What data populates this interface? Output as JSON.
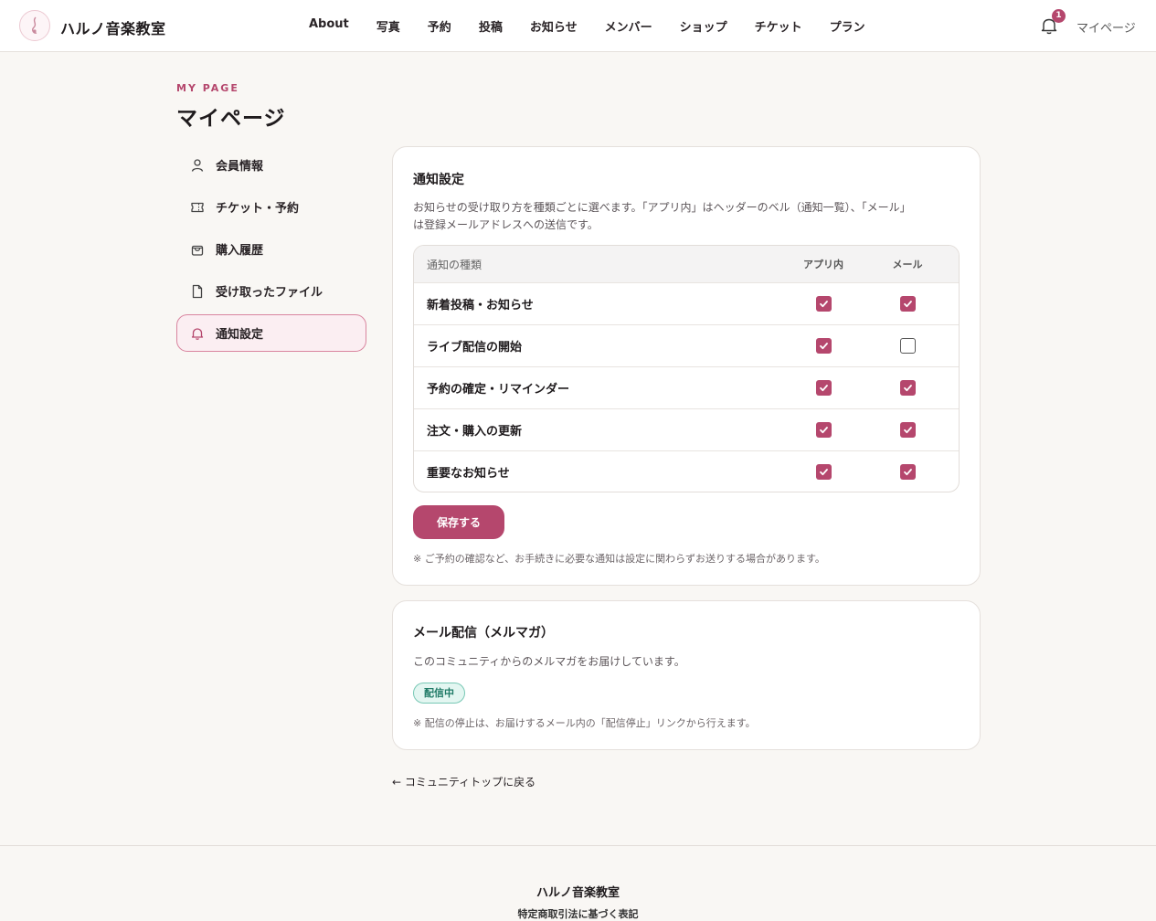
{
  "header": {
    "site_name": "ハルノ音楽教室",
    "nav": [
      "About",
      "写真",
      "予約",
      "投稿",
      "お知らせ",
      "メンバー",
      "ショップ",
      "チケット",
      "プラン"
    ],
    "notification_count": "1",
    "mypage_label": "マイページ"
  },
  "page": {
    "eyebrow": "MY PAGE",
    "title": "マイページ"
  },
  "sidebar": {
    "items": [
      {
        "label": "会員情報",
        "icon": "user-icon"
      },
      {
        "label": "チケット・予約",
        "icon": "ticket-icon"
      },
      {
        "label": "購入履歴",
        "icon": "bag-icon"
      },
      {
        "label": "受け取ったファイル",
        "icon": "file-icon"
      },
      {
        "label": "通知設定",
        "icon": "bell-icon",
        "active": true
      }
    ]
  },
  "notification_settings": {
    "title": "通知設定",
    "description_line1": "お知らせの受け取り方を種類ごとに選べます。「アプリ内」はヘッダーのベル（通知一覧）、「メール」",
    "description_line2": "は登録メールアドレスへの送信です。",
    "table": {
      "col_type": "通知の種類",
      "col_app": "アプリ内",
      "col_mail": "メール",
      "rows": [
        {
          "label": "新着投稿・お知らせ",
          "app": true,
          "mail": true
        },
        {
          "label": "ライブ配信の開始",
          "app": true,
          "mail": false
        },
        {
          "label": "予約の確定・リマインダー",
          "app": true,
          "mail": true
        },
        {
          "label": "注文・購入の更新",
          "app": true,
          "mail": true
        },
        {
          "label": "重要なお知らせ",
          "app": true,
          "mail": true
        }
      ]
    },
    "save_label": "保存する",
    "note": "※ ご予約の確認など、お手続きに必要な通知は設定に関わらずお送りする場合があります。"
  },
  "newsletter": {
    "title": "メール配信（メルマガ）",
    "description": "このコミュニティからのメルマガをお届けしています。",
    "status_badge": "配信中",
    "note": "※ 配信の停止は、お届けするメール内の「配信停止」リンクから行えます。"
  },
  "back_link": "← コミュニティトップに戻る",
  "footer": {
    "name": "ハルノ音楽教室",
    "legal_link": "特定商取引法に基づく表記"
  },
  "colors": {
    "accent": "#b5476d",
    "background": "#f9f7f4",
    "badge_green": "#1f7a66"
  }
}
